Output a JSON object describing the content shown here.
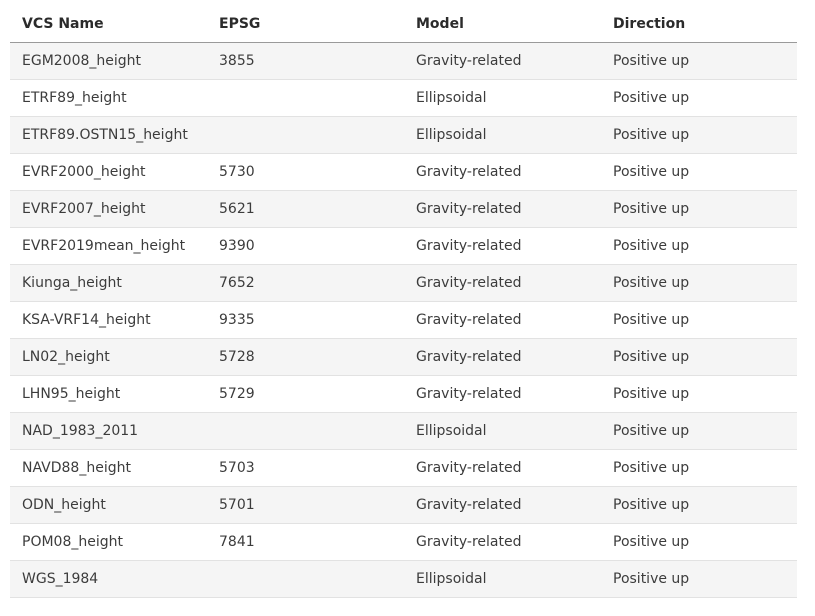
{
  "table": {
    "headers": [
      "VCS Name",
      "EPSG",
      "Model",
      "Direction"
    ],
    "rows": [
      [
        "EGM2008_height",
        "3855",
        "Gravity-related",
        "Positive up"
      ],
      [
        "ETRF89_height",
        "",
        "Ellipsoidal",
        "Positive up"
      ],
      [
        "ETRF89.OSTN15_height",
        "",
        "Ellipsoidal",
        "Positive up"
      ],
      [
        "EVRF2000_height",
        "5730",
        "Gravity-related",
        "Positive up"
      ],
      [
        "EVRF2007_height",
        "5621",
        "Gravity-related",
        "Positive up"
      ],
      [
        "EVRF2019mean_height",
        "9390",
        "Gravity-related",
        "Positive up"
      ],
      [
        "Kiunga_height",
        "7652",
        "Gravity-related",
        "Positive up"
      ],
      [
        "KSA-VRF14_height",
        "9335",
        "Gravity-related",
        "Positive up"
      ],
      [
        "LN02_height",
        "5728",
        "Gravity-related",
        "Positive up"
      ],
      [
        "LHN95_height",
        "5729",
        "Gravity-related",
        "Positive up"
      ],
      [
        "NAD_1983_2011",
        "",
        "Ellipsoidal",
        "Positive up"
      ],
      [
        "NAVD88_height",
        "5703",
        "Gravity-related",
        "Positive up"
      ],
      [
        "ODN_height",
        "5701",
        "Gravity-related",
        "Positive up"
      ],
      [
        "POM08_height",
        "7841",
        "Gravity-related",
        "Positive up"
      ],
      [
        "WGS_1984",
        "",
        "Ellipsoidal",
        "Positive up"
      ]
    ]
  }
}
